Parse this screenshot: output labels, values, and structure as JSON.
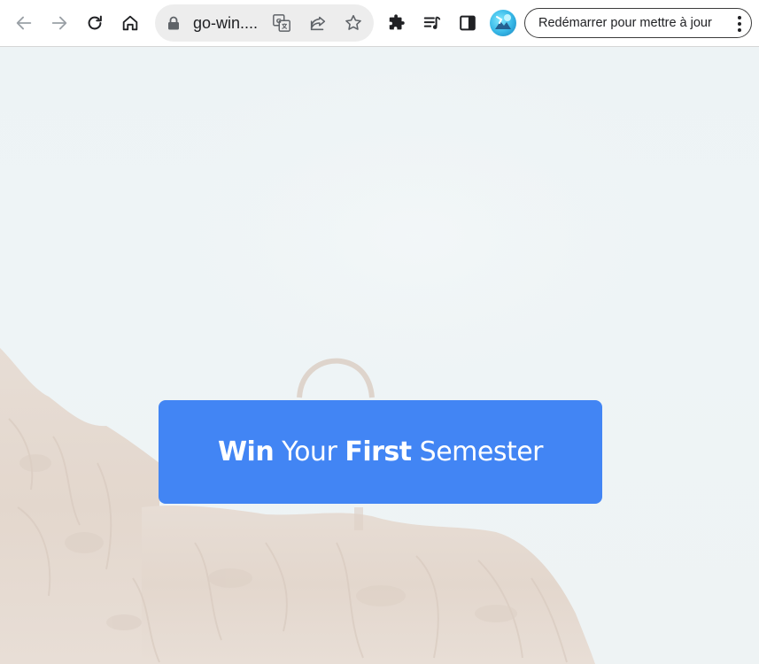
{
  "browser": {
    "url_display": "go-win....",
    "update_button_label": "Redémarrer pour mettre à jour",
    "icons": {
      "back": "arrow-left-icon",
      "forward": "arrow-right-icon",
      "reload": "reload-icon",
      "home": "home-icon",
      "lock": "lock-icon",
      "translate": "translate-icon",
      "share": "share-icon",
      "bookmark": "star-icon",
      "extensions": "puzzle-icon",
      "media": "media-queue-icon",
      "side_panel": "side-panel-icon",
      "menu": "kebab-menu-icon"
    }
  },
  "hero": {
    "word1": "Win",
    "word2": "Your",
    "word3": "First",
    "word4": "Semester"
  },
  "colors": {
    "hero_button": "#4285f4",
    "page_background": "#edf3f5",
    "toolbar_background": "#ffffff",
    "omnibox_background": "#ededed"
  }
}
